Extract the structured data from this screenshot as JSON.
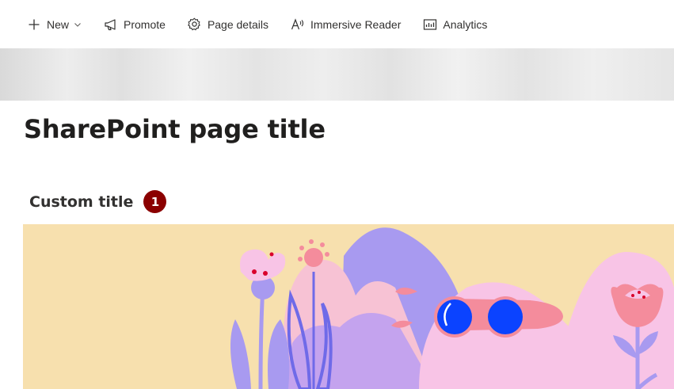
{
  "commandbar": {
    "items": [
      {
        "label": "New",
        "icon": "plus-icon",
        "has_dropdown": true
      },
      {
        "label": "Promote",
        "icon": "megaphone-icon"
      },
      {
        "label": "Page details",
        "icon": "gear-icon"
      },
      {
        "label": "Immersive Reader",
        "icon": "immersive-reader-icon"
      },
      {
        "label": "Analytics",
        "icon": "analytics-icon"
      }
    ]
  },
  "page": {
    "title": "SharePoint page title"
  },
  "section": {
    "title": "Custom title",
    "badge": "1"
  },
  "colors": {
    "badge": "#8b0000",
    "illustration_bg": "#f7e0ae",
    "purple": "#a89af0",
    "pink": "#f8c4e6",
    "salmon": "#f48c9c",
    "blue": "#0b43ff"
  }
}
